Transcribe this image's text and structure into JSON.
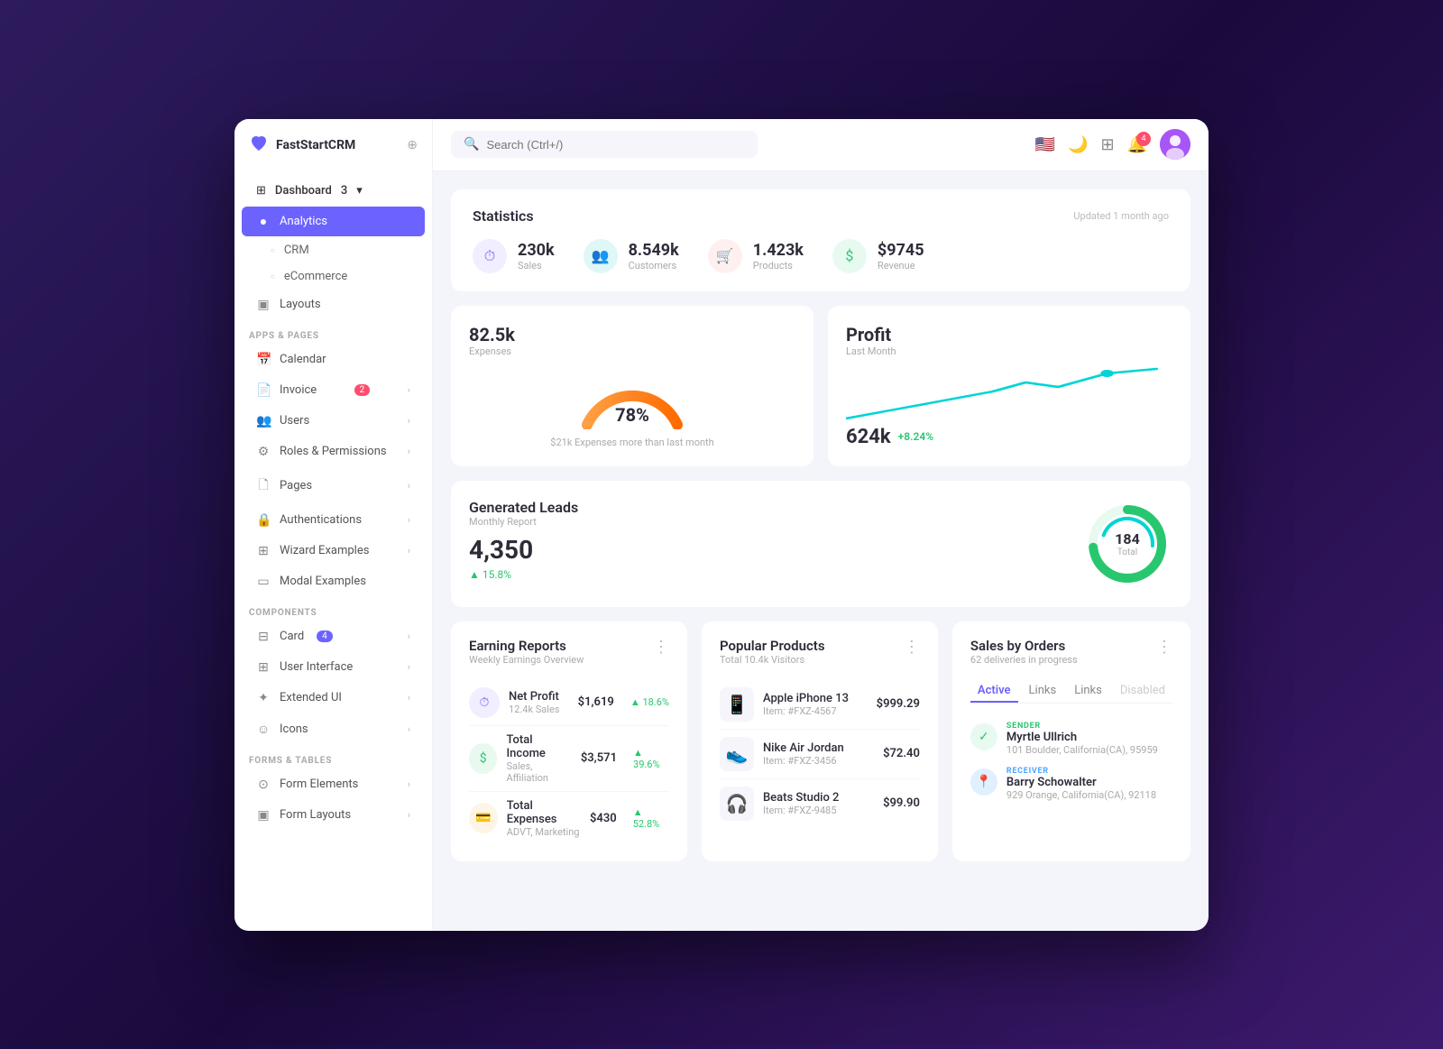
{
  "app": {
    "name": "FastStartCRM",
    "logo_icon": "♥"
  },
  "sidebar": {
    "dashboard_label": "Dashboard",
    "dashboard_count": "3",
    "analytics_label": "Analytics",
    "crm_label": "CRM",
    "ecommerce_label": "eCommerce",
    "layouts_label": "Layouts",
    "apps_pages_label": "APPS & PAGES",
    "calendar_label": "Calendar",
    "invoice_label": "Invoice",
    "invoice_badge": "2",
    "users_label": "Users",
    "roles_label": "Roles & Permissions",
    "pages_label": "Pages",
    "authentications_label": "Authentications",
    "wizard_label": "Wizard Examples",
    "modal_label": "Modal Examples",
    "components_label": "COMPONENTS",
    "card_label": "Card",
    "card_badge": "4",
    "ui_label": "User Interface",
    "extended_label": "Extended UI",
    "icons_label": "Icons",
    "forms_tables_label": "FORMS & TABLES",
    "form_elements_label": "Form Elements",
    "form_layouts_label": "Form Layouts"
  },
  "topbar": {
    "search_placeholder": "Search (Ctrl+/)",
    "notif_badge": "4"
  },
  "stats": {
    "title": "Statistics",
    "updated": "Updated 1 month ago",
    "sales_value": "230k",
    "sales_label": "Sales",
    "customers_value": "8.549k",
    "customers_label": "Customers",
    "products_value": "1.423k",
    "products_label": "Products",
    "revenue_value": "$9745",
    "revenue_label": "Revenue"
  },
  "expenses": {
    "value": "82.5k",
    "label": "Expenses",
    "percent": "78%",
    "sub": "$21k Expenses more than last month"
  },
  "profit": {
    "title": "Profit",
    "sub": "Last Month",
    "value": "624k",
    "growth": "+8.24%"
  },
  "leads": {
    "title": "Generated Leads",
    "sub": "Monthly Report",
    "value": "4,350",
    "total": "184",
    "total_label": "Total",
    "growth": "▲ 15.8%"
  },
  "earning": {
    "title": "Earning Reports",
    "sub": "Weekly Earnings Overview",
    "items": [
      {
        "name": "Net Profit",
        "detail": "12.4k Sales",
        "amount": "$1,619",
        "change": "▲ 18.6%",
        "up": true
      },
      {
        "name": "Total Income",
        "detail": "Sales, Affiliation",
        "amount": "$3,571",
        "change": "▲ 39.6%",
        "up": true
      },
      {
        "name": "Total Expenses",
        "detail": "ADVT, Marketing",
        "amount": "$430",
        "change": "▲ 52.8%",
        "up": true
      }
    ]
  },
  "products": {
    "title": "Popular Products",
    "sub": "Total 10.4k Visitors",
    "items": [
      {
        "name": "Apple iPhone 13",
        "id": "Item: #FXZ-4567",
        "price": "$999.29",
        "emoji": "📱"
      },
      {
        "name": "Nike Air Jordan",
        "id": "Item: #FXZ-3456",
        "price": "$72.40",
        "emoji": "👟"
      },
      {
        "name": "Beats Studio 2",
        "id": "Item: #FXZ-9485",
        "price": "$99.90",
        "emoji": "🎧"
      }
    ]
  },
  "orders": {
    "title": "Sales by Orders",
    "sub": "62 deliveries in progress",
    "tabs": [
      "Active",
      "Links",
      "Links",
      "Disabled"
    ],
    "active_tab": 0,
    "sender_label": "SENDER",
    "sender_name": "Myrtle Ullrich",
    "sender_address": "101 Boulder, California(CA), 95959",
    "receiver_label": "RECEIVER",
    "receiver_name": "Barry Schowalter",
    "receiver_address": "929 Orange, California(CA), 92118"
  }
}
